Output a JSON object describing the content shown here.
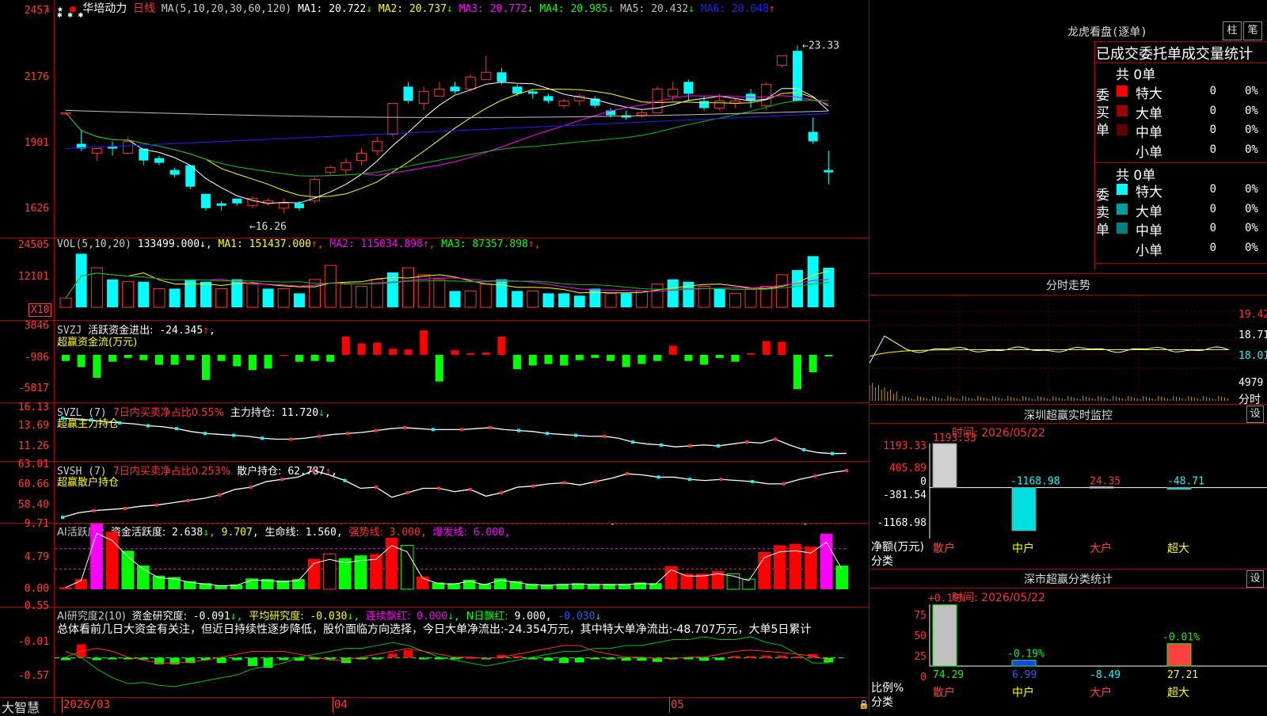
{
  "stock": {
    "name": "华培动力",
    "period": "日线",
    "ma_label": "MA(5,10,20,30,60,120)",
    "ma": [
      {
        "label": "MA1:",
        "value": "20.722",
        "dir": "↓",
        "color": "#ffffff"
      },
      {
        "label": "MA2:",
        "value": "20.737",
        "dir": "↓",
        "color": "#ffff00"
      },
      {
        "label": "MA3:",
        "value": "20.772",
        "dir": "↓",
        "color": "#ff00ff"
      },
      {
        "label": "MA4:",
        "value": "20.985",
        "dir": "↓",
        "color": "#00ff00"
      },
      {
        "label": "MA5:",
        "value": "20.432",
        "dir": "↓",
        "color": "#c0c0c0"
      },
      {
        "label": "MA6:",
        "value": "20.048",
        "dir": "↑",
        "color": "#2020ff"
      }
    ],
    "price_axis": [
      "2457",
      "2176",
      "1901",
      "1626"
    ],
    "high_marker": "23.33",
    "low_marker": "16.26"
  },
  "vol": {
    "label": "VOL(5,10,20)",
    "value": "133499.000",
    "ma": [
      {
        "label": "MA1:",
        "value": "151437.000",
        "dir": "↑",
        "color": "#ffff00"
      },
      {
        "label": "MA2:",
        "value": "115034.898",
        "dir": "↑",
        "color": "#ff00ff"
      },
      {
        "label": "MA3:",
        "value": "87357.898",
        "dir": "↑",
        "color": "#00ff00"
      }
    ],
    "axis": [
      "24505",
      "12101"
    ],
    "unit": "X10"
  },
  "svzj": {
    "label": "SVZJ",
    "desc": "活跃资金进出:",
    "value": "-24.345",
    "dir": "↑",
    "subtitle": "超赢资金流(万元)",
    "axis": [
      "3846",
      "-986",
      "-5817"
    ]
  },
  "svzl": {
    "label": "SVZL (7)",
    "desc": "7日内买卖净占比0.55%",
    "main_label": "主力持仓:",
    "main_value": "11.720",
    "dir": "↓",
    "subtitle": "超赢主力持仓",
    "axis": [
      "16.13",
      "13.69",
      "11.26"
    ]
  },
  "svsh": {
    "label": "SVSH (7)",
    "desc": "7日内买卖净占比0.253%",
    "main_label": "散户持仓:",
    "main_value": "62.787",
    "dir": "↑",
    "subtitle": "超赢散户持仓",
    "axis": [
      "63.01",
      "60.66",
      "58.40"
    ]
  },
  "ai_active": {
    "label": "AI活跃度2",
    "desc": "资金活跃度:",
    "v1": "2.638",
    "v2": "9.707",
    "life_label": "生命线:",
    "life": "1.560",
    "strong_label": "强势线:",
    "strong": "3.000",
    "burst_label": "爆发线:",
    "burst": "6.000",
    "axis": [
      "9.71",
      "4.79",
      "0.00"
    ]
  },
  "ai_research": {
    "label": "AI研究度2(10)",
    "desc": "资金研究度:",
    "value": "-0.091",
    "avg_label": "平均研究度:",
    "avg": "-0.030",
    "cont_label": "连续飘红:",
    "cont": "0.000",
    "n_label": "N日飘红:",
    "n": "9.000",
    "n2": "-0.030",
    "summary": "总体看前几日大资金有关注，但近日持续性逐步降低，股价面临方向选择，今日大单净流出:-24.354万元，其中特大单净流出:-48.707万元，大单5日累计",
    "axis": [
      "0.55",
      "-0.01",
      "-0.57"
    ]
  },
  "bottom": {
    "brand": "大智慧",
    "dates": [
      "2026/03",
      "04",
      "05"
    ]
  },
  "right": {
    "dragon_title": "龙虎看盘(逐单)",
    "btn_bar": "柱",
    "btn_pen": "笔",
    "tabs": [
      "已成交",
      "委托单",
      "成交量统计"
    ],
    "buy_side": "委买单",
    "sell_side": "委卖单",
    "buy_total": "共 0单",
    "sell_total": "共 0单",
    "buy_rows": [
      {
        "label": "特大",
        "val": "0",
        "pct": "0%",
        "color": "#ff0000"
      },
      {
        "label": "大单",
        "val": "0",
        "pct": "0%",
        "color": "#a00000"
      },
      {
        "label": "中单",
        "val": "0",
        "pct": "0%",
        "color": "#600000"
      },
      {
        "label": "小单",
        "val": "0",
        "pct": "0%",
        "color": "#000000"
      }
    ],
    "sell_rows": [
      {
        "label": "特大",
        "val": "0",
        "pct": "0%",
        "color": "#00ffff"
      },
      {
        "label": "大单",
        "val": "0",
        "pct": "0%",
        "color": "#00a0a0"
      },
      {
        "label": "中单",
        "val": "0",
        "pct": "0%",
        "color": "#008080"
      },
      {
        "label": "小单",
        "val": "0",
        "pct": "0%",
        "color": "#000000"
      }
    ],
    "intraday_title": "分时走势",
    "intraday_axis": [
      "19.42",
      "18.71",
      "18.01",
      "4979"
    ],
    "intraday_unit": "分时",
    "monitor_title": "深圳超赢实时监控",
    "monitor_btn": "设",
    "monitor_time_label": "时间:",
    "monitor_time": "2026/05/22",
    "monitor_axis": [
      "1193.33",
      "405.89",
      "0",
      "-381.54",
      "-1168.98"
    ],
    "monitor_ylabel": "净额(万元)",
    "monitor_xlabel": "分类",
    "monitor_bars": [
      {
        "cat": "散户",
        "value": "1193.33",
        "cat_color": "#ff4040",
        "val_color": "#ff3030"
      },
      {
        "cat": "中户",
        "value": "-1168.98",
        "cat_color": "#ffff00",
        "val_color": "#00ffff"
      },
      {
        "cat": "大户",
        "value": "24.35",
        "cat_color": "#ff4040",
        "val_color": "#ff3030"
      },
      {
        "cat": "超大",
        "value": "-48.71",
        "cat_color": "#ffff00",
        "val_color": "#00ffff"
      }
    ],
    "class_title": "深市超赢分类统计",
    "class_btn": "设",
    "class_time_label": "时间:",
    "class_time": "2026/05/22",
    "class_axis": [
      "75",
      "50",
      "25",
      "0"
    ],
    "class_ylabel": "比例%",
    "class_xlabel": "分类",
    "class_bars": [
      {
        "cat": "散户",
        "value": "74.29",
        "change": "+0.19%",
        "change_color": "#ff3030",
        "val_color": "#00ff00"
      },
      {
        "cat": "中户",
        "value": "6.99",
        "change": "-0.19%",
        "change_color": "#00ff00",
        "val_color": "#2060ff"
      },
      {
        "cat": "大户",
        "value": "-8.49",
        "change": "",
        "change_color": "#00ff00",
        "val_color": "#00ffff"
      },
      {
        "cat": "超大",
        "value": "27.21",
        "change": "-0.01%",
        "change_color": "#00ff00",
        "val_color": "#ffff00"
      }
    ]
  },
  "chart_data": [
    {
      "type": "candlestick",
      "title": "华培动力 日线",
      "ylim": [
        16.26,
        24.57
      ],
      "candles": [
        [
          20.5,
          20.5,
          20.5,
          20.5
        ],
        [
          19.2,
          19.0,
          19.8,
          18.9
        ],
        [
          18.8,
          19.0,
          19.0,
          18.5
        ],
        [
          19.1,
          19.0,
          19.3,
          18.7
        ],
        [
          18.8,
          19.3,
          19.5,
          18.8
        ],
        [
          19.0,
          18.5,
          19.0,
          18.3
        ],
        [
          18.6,
          18.4,
          18.7,
          18.3
        ],
        [
          18.1,
          17.9,
          18.2,
          17.8
        ],
        [
          18.3,
          17.4,
          18.3,
          17.3
        ],
        [
          17.1,
          16.5,
          17.1,
          16.4
        ],
        [
          16.7,
          16.6,
          16.8,
          16.4
        ],
        [
          16.9,
          16.7,
          16.9,
          16.6
        ],
        [
          16.6,
          16.9,
          17.0,
          16.5
        ],
        [
          16.7,
          16.8,
          16.9,
          16.6
        ],
        [
          16.5,
          16.7,
          16.9,
          16.3
        ],
        [
          16.7,
          16.5,
          16.8,
          16.4
        ],
        [
          16.8,
          17.7,
          17.8,
          16.7
        ],
        [
          18.0,
          18.2,
          18.3,
          17.9
        ],
        [
          18.1,
          18.4,
          18.6,
          17.9
        ],
        [
          18.5,
          18.8,
          19.0,
          18.3
        ],
        [
          18.9,
          19.3,
          19.5,
          18.7
        ],
        [
          19.6,
          20.9,
          20.9,
          19.5
        ],
        [
          21.6,
          21.0,
          21.8,
          20.9
        ],
        [
          20.9,
          21.4,
          21.6,
          20.6
        ],
        [
          21.2,
          21.5,
          21.8,
          21.2
        ],
        [
          21.6,
          21.4,
          21.8,
          21.3
        ],
        [
          21.5,
          22.0,
          22.1,
          21.4
        ],
        [
          21.9,
          22.2,
          22.9,
          21.9
        ],
        [
          22.2,
          21.8,
          22.4,
          21.7
        ],
        [
          21.6,
          21.3,
          21.7,
          21.2
        ],
        [
          21.4,
          21.3,
          21.5,
          21.1
        ],
        [
          21.2,
          21.0,
          21.3,
          20.9
        ],
        [
          20.8,
          21.0,
          21.1,
          20.7
        ],
        [
          21.0,
          21.2,
          21.3,
          20.8
        ],
        [
          21.1,
          20.8,
          21.2,
          20.7
        ],
        [
          20.6,
          20.4,
          20.7,
          20.3
        ],
        [
          20.4,
          20.3,
          20.6,
          20.2
        ],
        [
          20.4,
          20.5,
          20.6,
          20.3
        ],
        [
          20.5,
          21.5,
          21.6,
          20.5
        ],
        [
          21.2,
          21.5,
          21.8,
          21.0
        ],
        [
          21.8,
          21.3,
          21.9,
          21.0
        ],
        [
          21.0,
          20.7,
          21.2,
          20.6
        ],
        [
          20.7,
          21.0,
          21.3,
          20.6
        ],
        [
          20.9,
          21.0,
          21.1,
          20.7
        ],
        [
          21.3,
          21.0,
          21.5,
          20.7
        ],
        [
          20.8,
          21.7,
          21.8,
          20.6
        ],
        [
          22.5,
          22.9,
          22.9,
          22.4
        ],
        [
          23.1,
          21.0,
          23.33,
          21.0
        ],
        [
          19.7,
          19.3,
          20.3,
          19.2
        ],
        [
          18.1,
          18.0,
          18.9,
          17.5
        ]
      ]
    },
    {
      "type": "bar",
      "title": "VOL(5,10,20)",
      "ylim": [
        0,
        24505
      ],
      "values": [
        4000,
        23000,
        17000,
        12000,
        11000,
        11000,
        8000,
        8000,
        12000,
        11000,
        8000,
        12000,
        10000,
        8000,
        8000,
        6000,
        12000,
        18000,
        10000,
        9000,
        12000,
        15000,
        17000,
        14000,
        12000,
        7000,
        7000,
        10000,
        12000,
        7000,
        7000,
        6000,
        6000,
        5000,
        8000,
        6000,
        6000,
        7000,
        10000,
        12000,
        11000,
        9000,
        8000,
        6000,
        8000,
        9000,
        14000,
        16000,
        22000,
        17000
      ],
      "colors": [
        "u",
        "d",
        "u",
        "d",
        "u",
        "d",
        "u",
        "d",
        "d",
        "d",
        "u",
        "d",
        "u",
        "d",
        "u",
        "d",
        "u",
        "u",
        "u",
        "u",
        "u",
        "d",
        "u",
        "u",
        "u",
        "d",
        "u",
        "u",
        "d",
        "d",
        "u",
        "d",
        "d",
        "d",
        "d",
        "u",
        "d",
        "u",
        "u",
        "d",
        "d",
        "u",
        "d",
        "u",
        "u",
        "u",
        "u",
        "d",
        "d",
        "d"
      ]
    },
    {
      "type": "bar",
      "title": "超赢资金流(万元)",
      "ylim": [
        -5817,
        3846
      ],
      "values": [
        -800,
        -1600,
        -3000,
        -900,
        -400,
        -700,
        -1300,
        -1300,
        -700,
        -3300,
        -800,
        -1500,
        -2000,
        -1800,
        0,
        -900,
        -800,
        -900,
        2400,
        1500,
        1600,
        800,
        700,
        3200,
        -3500,
        600,
        200,
        300,
        2400,
        -1900,
        -1400,
        -1200,
        -1400,
        -700,
        -400,
        -800,
        -1600,
        -1200,
        -800,
        1200,
        -800,
        -1300,
        -400,
        -900,
        200,
        1800,
        1700,
        -4500,
        -2300,
        -200
      ]
    },
    {
      "type": "line",
      "title": "超赢主力持仓",
      "ylim": [
        11.26,
        16.13
      ],
      "values": [
        15.4,
        15.3,
        15.2,
        15.0,
        14.9,
        14.8,
        14.6,
        14.5,
        14.3,
        14.0,
        13.8,
        13.7,
        13.6,
        13.5,
        13.3,
        13.2,
        13.2,
        13.3,
        13.5,
        13.7,
        13.8,
        13.9,
        14.1,
        14.3,
        14.4,
        14.3,
        14.2,
        14.2,
        14.2,
        14.3,
        14.4,
        14.2,
        14.1,
        14.0,
        13.8,
        13.7,
        13.6,
        13.5,
        13.5,
        13.3,
        12.9,
        12.7,
        12.6,
        12.4,
        12.5,
        12.6,
        12.5,
        12.7,
        12.9,
        12.8,
        13.2,
        12.6,
        12.1,
        11.8,
        11.7,
        11.72
      ]
    },
    {
      "type": "line",
      "title": "超赢散户持仓",
      "ylim": [
        58.4,
        63.01
      ],
      "values": [
        58.6,
        59.0,
        59.2,
        59.3,
        59.4,
        59.6,
        59.7,
        59.9,
        60.1,
        60.3,
        60.6,
        61.1,
        61.3,
        61.8,
        62.0,
        62.2,
        62.8,
        62.4,
        61.9,
        61.2,
        61.3,
        60.4,
        60.8,
        61.2,
        61.2,
        60.9,
        61.1,
        60.5,
        60.8,
        61.3,
        61.4,
        61.6,
        61.7,
        61.5,
        61.8,
        62.1,
        62.5,
        62.4,
        62.2,
        62.2,
        62.0,
        61.9,
        62.0,
        61.9,
        61.8,
        61.6,
        61.6,
        62.0,
        62.3,
        62.6,
        62.787
      ]
    },
    {
      "type": "bar",
      "title": "AI活跃度2",
      "ylim": [
        0,
        9.71
      ],
      "values": [
        0.3,
        1.5,
        9.71,
        8.5,
        5.7,
        3.5,
        2.0,
        1.8,
        1.2,
        0.9,
        0.6,
        0.7,
        1.6,
        1.5,
        1.3,
        1.5,
        4.5,
        5.2,
        4.6,
        5.0,
        5.2,
        7.6,
        6.5,
        1.9,
        1.0,
        0.9,
        1.4,
        0.8,
        1.6,
        1.2,
        0.8,
        0.7,
        0.8,
        0.9,
        0.8,
        0.8,
        0.8,
        1.0,
        0.9,
        3.4,
        2.3,
        2.3,
        2.7,
        2.3,
        1.5,
        5.5,
        6.5,
        6.7,
        6.3,
        8.2,
        3.5
      ],
      "colors": [
        "r",
        "r",
        "m",
        "r",
        "g",
        "g",
        "g",
        "g",
        "g",
        "g",
        "g",
        "g",
        "g",
        "g",
        "g",
        "g",
        "r",
        "ro",
        "g",
        "g",
        "r",
        "r",
        "go",
        "r",
        "g",
        "g",
        "g",
        "g",
        "g",
        "g",
        "g",
        "g",
        "g",
        "g",
        "g",
        "g",
        "g",
        "g",
        "g",
        "r",
        "r",
        "r",
        "r",
        "go",
        "go",
        "r",
        "r",
        "r",
        "r",
        "m",
        "g"
      ]
    },
    {
      "type": "bar",
      "title": "AI研究度2(10)",
      "ylim": [
        -0.57,
        0.55
      ],
      "values": [
        -0.05,
        0.22,
        -0.05,
        -0.02,
        -0.01,
        -0.04,
        -0.12,
        -0.12,
        -0.1,
        -0.05,
        -0.1,
        -0.05,
        -0.15,
        -0.18,
        -0.05,
        -0.06,
        -0.02,
        -0.01,
        -0.1,
        -0.01,
        -0.02,
        0.06,
        0.12,
        -0.01,
        -0.02,
        -0.01,
        0.0,
        -0.03,
        0.04,
        0.02,
        -0.03,
        -0.06,
        -0.1,
        -0.09,
        -0.01,
        -0.01,
        -0.06,
        -0.06,
        -0.08,
        -0.02,
        -0.02,
        -0.06,
        -0.05,
        0.02,
        0.02,
        0.03,
        0.03,
        0.01,
        0.05,
        -0.09
      ]
    }
  ]
}
